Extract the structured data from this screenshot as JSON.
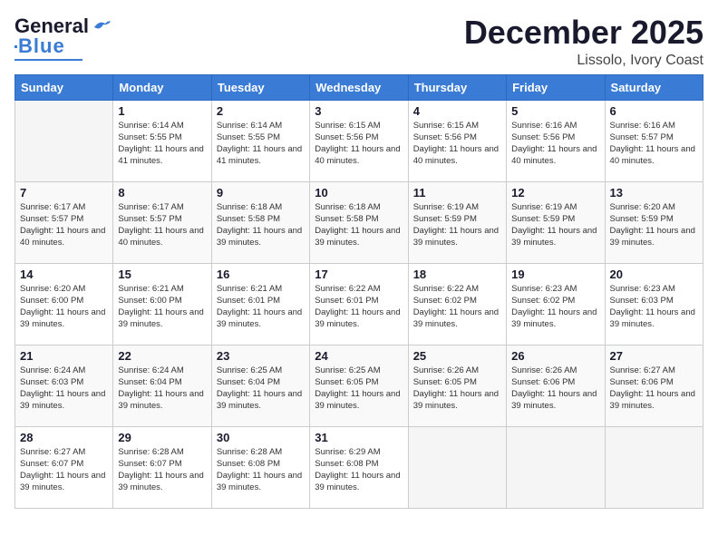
{
  "header": {
    "logo_general": "General",
    "logo_blue": "Blue",
    "month": "December 2025",
    "location": "Lissolo, Ivory Coast"
  },
  "days_of_week": [
    "Sunday",
    "Monday",
    "Tuesday",
    "Wednesday",
    "Thursday",
    "Friday",
    "Saturday"
  ],
  "weeks": [
    [
      {
        "day": "",
        "info": ""
      },
      {
        "day": "1",
        "info": "Sunrise: 6:14 AM\nSunset: 5:55 PM\nDaylight: 11 hours\nand 41 minutes."
      },
      {
        "day": "2",
        "info": "Sunrise: 6:14 AM\nSunset: 5:55 PM\nDaylight: 11 hours\nand 41 minutes."
      },
      {
        "day": "3",
        "info": "Sunrise: 6:15 AM\nSunset: 5:56 PM\nDaylight: 11 hours\nand 40 minutes."
      },
      {
        "day": "4",
        "info": "Sunrise: 6:15 AM\nSunset: 5:56 PM\nDaylight: 11 hours\nand 40 minutes."
      },
      {
        "day": "5",
        "info": "Sunrise: 6:16 AM\nSunset: 5:56 PM\nDaylight: 11 hours\nand 40 minutes."
      },
      {
        "day": "6",
        "info": "Sunrise: 6:16 AM\nSunset: 5:57 PM\nDaylight: 11 hours\nand 40 minutes."
      }
    ],
    [
      {
        "day": "7",
        "info": "Sunrise: 6:17 AM\nSunset: 5:57 PM\nDaylight: 11 hours\nand 40 minutes."
      },
      {
        "day": "8",
        "info": "Sunrise: 6:17 AM\nSunset: 5:57 PM\nDaylight: 11 hours\nand 40 minutes."
      },
      {
        "day": "9",
        "info": "Sunrise: 6:18 AM\nSunset: 5:58 PM\nDaylight: 11 hours\nand 39 minutes."
      },
      {
        "day": "10",
        "info": "Sunrise: 6:18 AM\nSunset: 5:58 PM\nDaylight: 11 hours\nand 39 minutes."
      },
      {
        "day": "11",
        "info": "Sunrise: 6:19 AM\nSunset: 5:59 PM\nDaylight: 11 hours\nand 39 minutes."
      },
      {
        "day": "12",
        "info": "Sunrise: 6:19 AM\nSunset: 5:59 PM\nDaylight: 11 hours\nand 39 minutes."
      },
      {
        "day": "13",
        "info": "Sunrise: 6:20 AM\nSunset: 5:59 PM\nDaylight: 11 hours\nand 39 minutes."
      }
    ],
    [
      {
        "day": "14",
        "info": "Sunrise: 6:20 AM\nSunset: 6:00 PM\nDaylight: 11 hours\nand 39 minutes."
      },
      {
        "day": "15",
        "info": "Sunrise: 6:21 AM\nSunset: 6:00 PM\nDaylight: 11 hours\nand 39 minutes."
      },
      {
        "day": "16",
        "info": "Sunrise: 6:21 AM\nSunset: 6:01 PM\nDaylight: 11 hours\nand 39 minutes."
      },
      {
        "day": "17",
        "info": "Sunrise: 6:22 AM\nSunset: 6:01 PM\nDaylight: 11 hours\nand 39 minutes."
      },
      {
        "day": "18",
        "info": "Sunrise: 6:22 AM\nSunset: 6:02 PM\nDaylight: 11 hours\nand 39 minutes."
      },
      {
        "day": "19",
        "info": "Sunrise: 6:23 AM\nSunset: 6:02 PM\nDaylight: 11 hours\nand 39 minutes."
      },
      {
        "day": "20",
        "info": "Sunrise: 6:23 AM\nSunset: 6:03 PM\nDaylight: 11 hours\nand 39 minutes."
      }
    ],
    [
      {
        "day": "21",
        "info": "Sunrise: 6:24 AM\nSunset: 6:03 PM\nDaylight: 11 hours\nand 39 minutes."
      },
      {
        "day": "22",
        "info": "Sunrise: 6:24 AM\nSunset: 6:04 PM\nDaylight: 11 hours\nand 39 minutes."
      },
      {
        "day": "23",
        "info": "Sunrise: 6:25 AM\nSunset: 6:04 PM\nDaylight: 11 hours\nand 39 minutes."
      },
      {
        "day": "24",
        "info": "Sunrise: 6:25 AM\nSunset: 6:05 PM\nDaylight: 11 hours\nand 39 minutes."
      },
      {
        "day": "25",
        "info": "Sunrise: 6:26 AM\nSunset: 6:05 PM\nDaylight: 11 hours\nand 39 minutes."
      },
      {
        "day": "26",
        "info": "Sunrise: 6:26 AM\nSunset: 6:06 PM\nDaylight: 11 hours\nand 39 minutes."
      },
      {
        "day": "27",
        "info": "Sunrise: 6:27 AM\nSunset: 6:06 PM\nDaylight: 11 hours\nand 39 minutes."
      }
    ],
    [
      {
        "day": "28",
        "info": "Sunrise: 6:27 AM\nSunset: 6:07 PM\nDaylight: 11 hours\nand 39 minutes."
      },
      {
        "day": "29",
        "info": "Sunrise: 6:28 AM\nSunset: 6:07 PM\nDaylight: 11 hours\nand 39 minutes."
      },
      {
        "day": "30",
        "info": "Sunrise: 6:28 AM\nSunset: 6:08 PM\nDaylight: 11 hours\nand 39 minutes."
      },
      {
        "day": "31",
        "info": "Sunrise: 6:29 AM\nSunset: 6:08 PM\nDaylight: 11 hours\nand 39 minutes."
      },
      {
        "day": "",
        "info": ""
      },
      {
        "day": "",
        "info": ""
      },
      {
        "day": "",
        "info": ""
      }
    ]
  ]
}
